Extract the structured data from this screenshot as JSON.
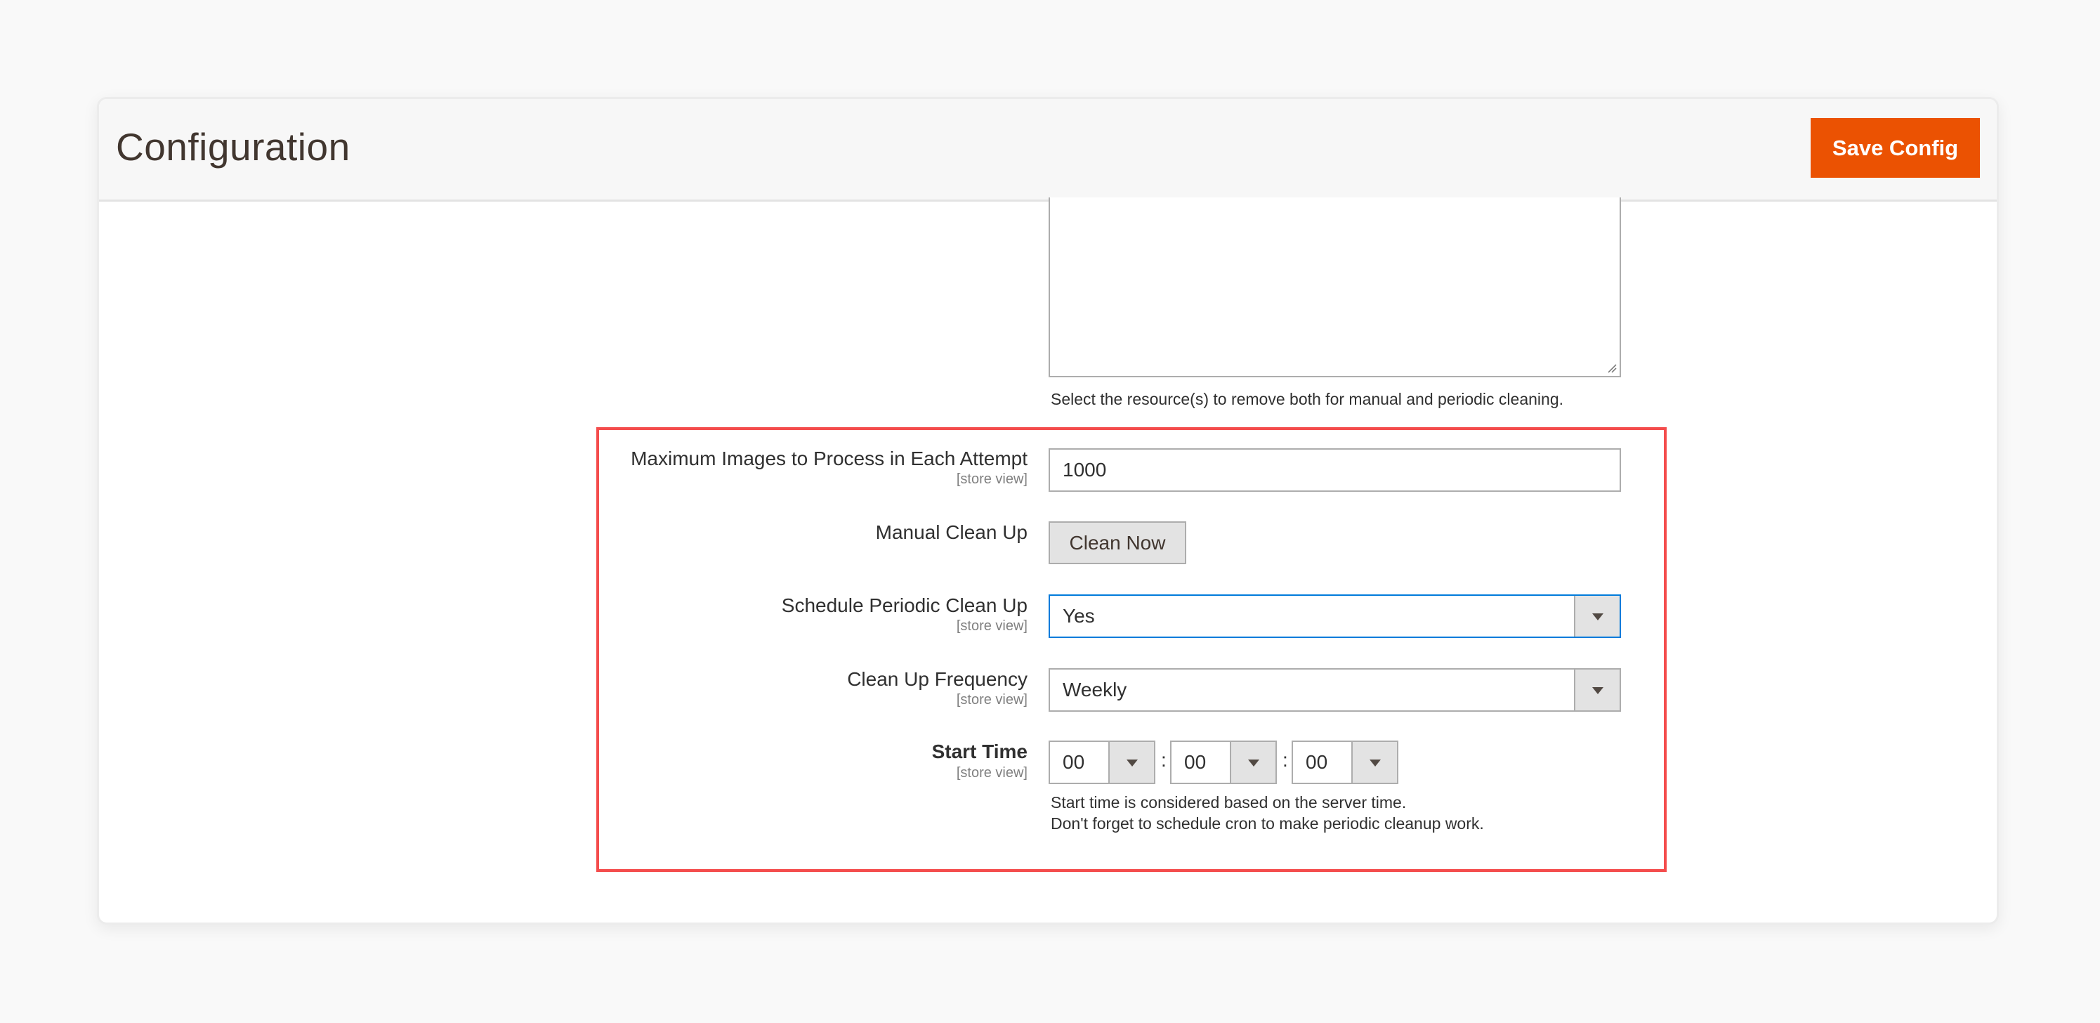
{
  "header": {
    "title": "Configuration",
    "save_button": "Save Config"
  },
  "resources": {
    "note": "Select the resource(s) to remove both for manual and periodic cleaning."
  },
  "fields": {
    "max_images": {
      "label": "Maximum Images to Process in Each Attempt",
      "scope": "[store view]",
      "value": "1000"
    },
    "manual_cleanup": {
      "label": "Manual Clean Up",
      "button": "Clean Now"
    },
    "schedule_periodic": {
      "label": "Schedule Periodic Clean Up",
      "scope": "[store view]",
      "value": "Yes"
    },
    "frequency": {
      "label": "Clean Up Frequency",
      "scope": "[store view]",
      "value": "Weekly"
    },
    "start_time": {
      "label": "Start Time",
      "scope": "[store view]",
      "hour": "00",
      "minute": "00",
      "second": "00",
      "separator": ":",
      "note_line1": "Start time is considered based on the server time.",
      "note_line2": "Don't forget to schedule cron to make periodic cleanup work."
    }
  },
  "colors": {
    "accent": "#eb5202",
    "focus": "#007bdb",
    "highlight": "#f44c4c"
  }
}
